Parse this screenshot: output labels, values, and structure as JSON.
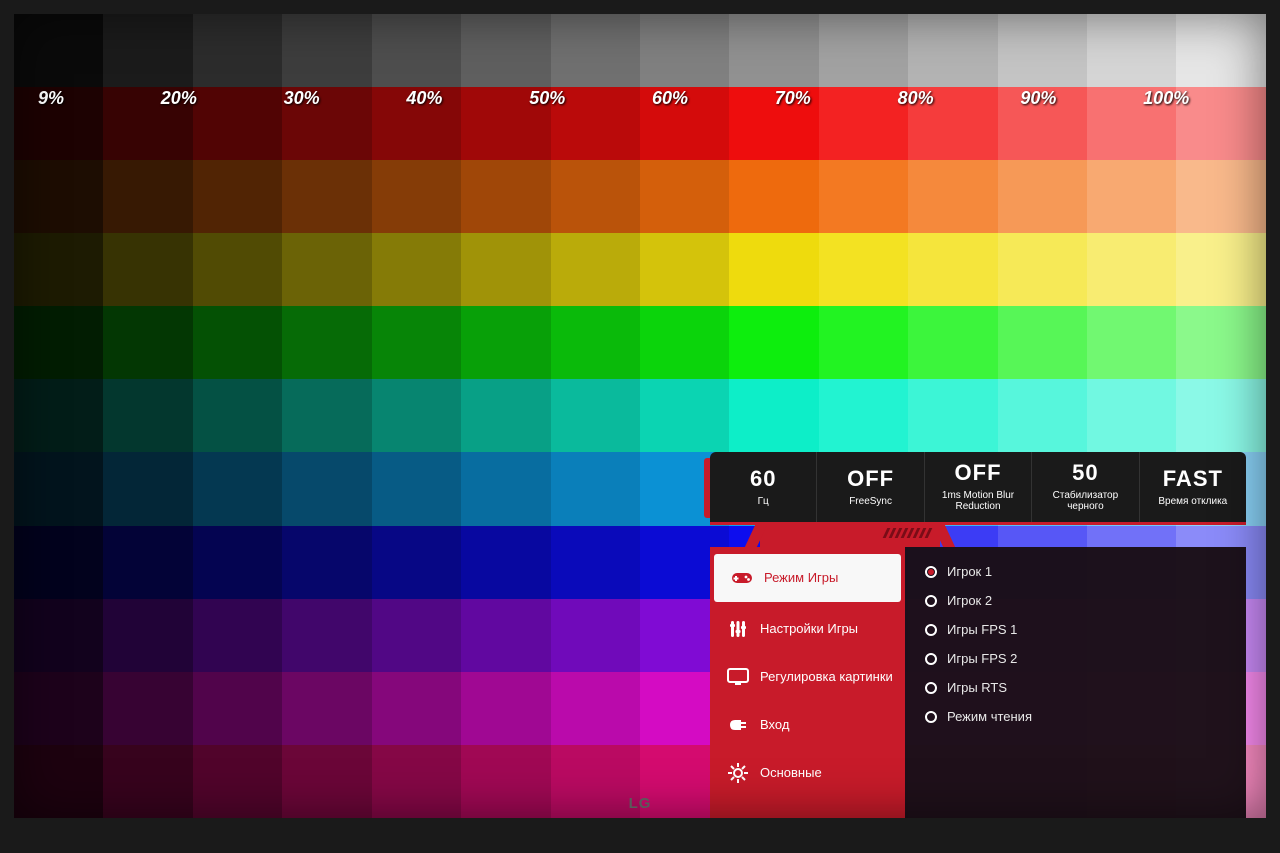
{
  "brand": "LG",
  "grayscale_labels": [
    "9%",
    "20%",
    "30%",
    "40%",
    "50%",
    "60%",
    "70%",
    "80%",
    "90%",
    "100%"
  ],
  "color_rows_hue": [
    "gray",
    "red",
    "orange",
    "yellow",
    "green",
    "cyan",
    "azure",
    "blue",
    "violet",
    "magenta",
    "pink"
  ],
  "osd": {
    "status": [
      {
        "value": "60",
        "label": "Гц"
      },
      {
        "value": "OFF",
        "label": "FreeSync"
      },
      {
        "value": "OFF",
        "label": "1ms Motion Blur Reduction"
      },
      {
        "value": "50",
        "label": "Стабилизатор черного"
      },
      {
        "value": "FAST",
        "label": "Время отклика"
      }
    ],
    "menu": [
      {
        "icon": "gamepad",
        "label": "Режим Игры",
        "active": true
      },
      {
        "icon": "sliders",
        "label": "Настройки Игры",
        "active": false
      },
      {
        "icon": "display",
        "label": "Регулировка картинки",
        "active": false
      },
      {
        "icon": "plug",
        "label": "Вход",
        "active": false
      },
      {
        "icon": "gear",
        "label": "Основные",
        "active": false
      }
    ],
    "submenu": [
      {
        "label": "Игрок 1",
        "selected": true
      },
      {
        "label": "Игрок 2",
        "selected": false
      },
      {
        "label": "Игры FPS 1",
        "selected": false
      },
      {
        "label": "Игры FPS 2",
        "selected": false
      },
      {
        "label": "Игры RTS",
        "selected": false
      },
      {
        "label": "Режим чтения",
        "selected": false
      }
    ]
  }
}
